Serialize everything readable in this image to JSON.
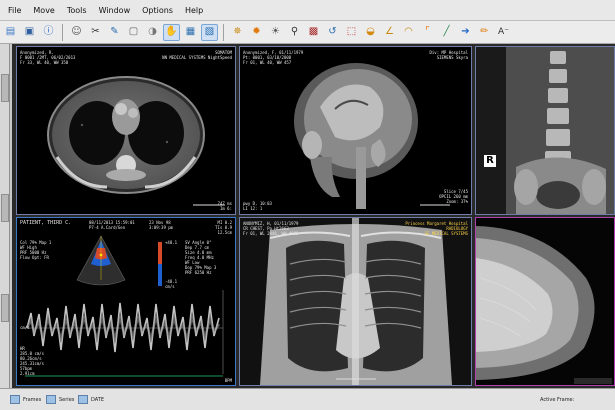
{
  "menubar": {
    "items": [
      "File",
      "Move",
      "Tools",
      "Window",
      "Options",
      "Help"
    ]
  },
  "toolbar": {
    "icons": [
      "open-folder-icon",
      "save-icon",
      "info-icon",
      "patient-icon",
      "scissors-icon",
      "pencil-icon",
      "crop-icon",
      "brightness-icon",
      "hand-icon",
      "layout-grid-icon",
      "layout-2x3-icon",
      "magnify-icon",
      "star-icon",
      "sun-icon",
      "search-icon",
      "mosaic-icon",
      "reset-icon",
      "region-icon",
      "palette-icon",
      "angle-icon",
      "arc-icon",
      "corner-icon",
      "line-icon",
      "arrow-icon",
      "highlighter-icon",
      "text-icon"
    ]
  },
  "viewports": {
    "ct": {
      "tl": [
        "Anonymized, R.",
        "F 0001 /2MT, 06/02/2013",
        "Fr 33, WL 40, WW 350"
      ],
      "tr": [
        "SOMATOM",
        "NN MEDICAL SYSTEMS NightSpeed"
      ],
      "br": [
        "747 ms",
        "Im 6:"
      ]
    },
    "mri": {
      "tl": [
        "Anonymized, F, 01/11/1979",
        "Pt: 0001, 03/10/2008",
        "Fr 01, WL 40, WW 457"
      ],
      "tr": [
        "Div: MP Hospital",
        "SIEMENS Skyra"
      ],
      "bl": [
        "pwy D, 10:03",
        "LI 12: 1"
      ],
      "br": [
        "Slice 7/45",
        "OPCIL 260 mm",
        "Zoom: 37%"
      ]
    },
    "us": {
      "header_left": "PATIENT, THIRD C.",
      "header_mid": [
        "08/11/2013 15:59:01",
        "P7-4 A.Card/Gen"
      ],
      "header_right": [
        "MI 0.2",
        "TIs 0.9",
        "12.5cm"
      ],
      "date": [
        "23 Nov 98",
        "3:09:39 pm"
      ],
      "left_params": [
        "Col 79% Map 1",
        "WF High",
        "PRF 5000 Hz",
        "Flow Opt: FR"
      ],
      "right_params": [
        "SV Angle 0°",
        "Dep 7.7 cm",
        "Size 4.0 mm",
        "Freq 4.0 MHz",
        "WF Low",
        "Dop 79% Map 3",
        "PRF 6250 Hz"
      ],
      "scale_top": "+48.1",
      "scale_bottom": "-48.1",
      "scale_unit": "cm/s",
      "cm_s_label": "cm/s",
      "bottom_left": [
        "HR",
        "285.0 cm/s",
        "80.26cm/s",
        "245.31cm/s",
        "57bpm",
        "2.91cm"
      ],
      "bpm_label": "BPM"
    },
    "xray": {
      "tl": [
        "ANONYMIZ, H, 01/11/1979",
        "CR CHEST, Pa Ht2663",
        "Fr 01, WL 2048, WW 4096"
      ],
      "tr": [
        "Princess Margaret Hospital",
        "RADIOLOGY",
        "GE MEDICAL SYSTEMS"
      ]
    },
    "spine": {
      "marker": "R"
    }
  },
  "statusbar": {
    "items": [
      "Frames",
      "Series",
      "DATE"
    ],
    "right": "Active Frame:"
  },
  "colors": {
    "frame_blue": "#3a78c8",
    "frame_magenta": "#b040b0",
    "overlay_yellow": "#ffd54a"
  }
}
